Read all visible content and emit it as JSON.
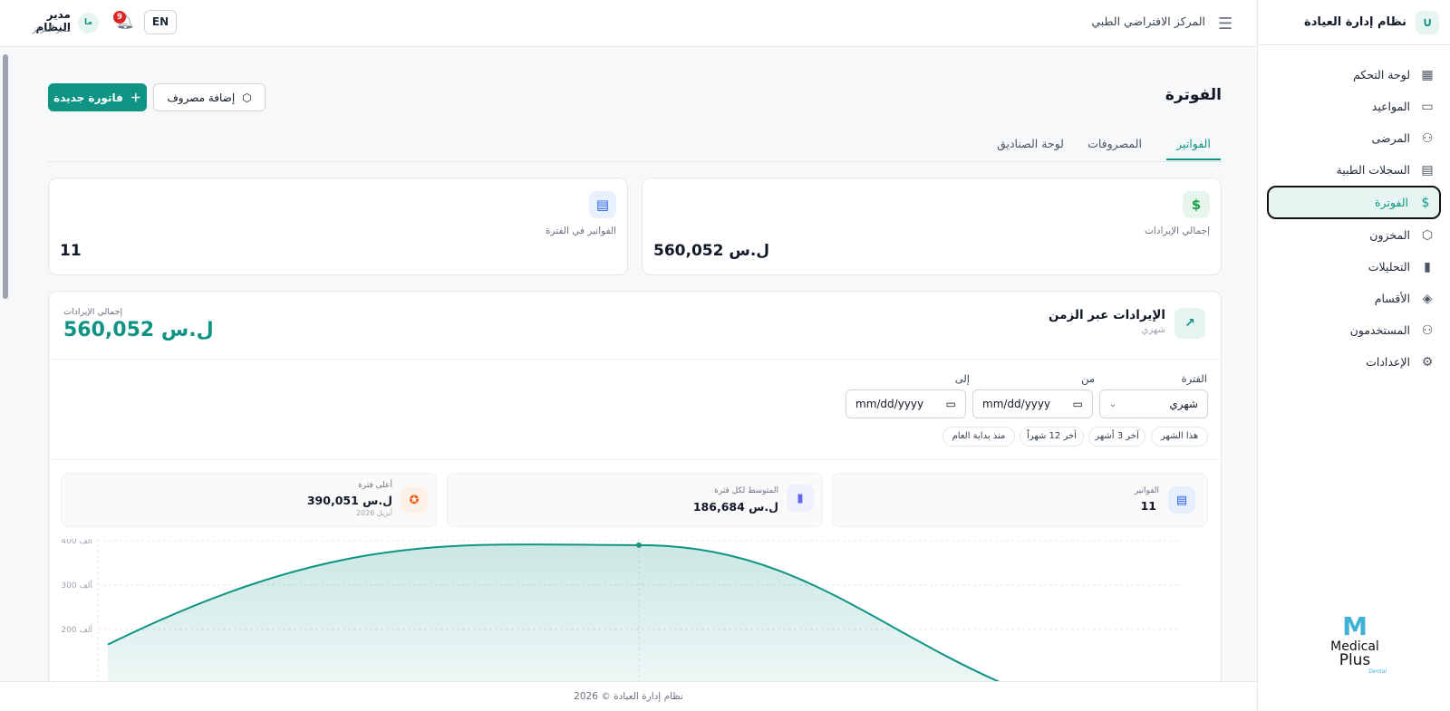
{
  "sidebar": {
    "brand": "نظام إدارة العيادة",
    "items": [
      {
        "label": "لوحة التحكم",
        "icon": "dashboard-icon",
        "glyph": "▦"
      },
      {
        "label": "المواعيد",
        "icon": "calendar-icon",
        "glyph": "▭"
      },
      {
        "label": "المرضى",
        "icon": "users-icon",
        "glyph": "⚇"
      },
      {
        "label": "السجلات الطبية",
        "icon": "file-icon",
        "glyph": "▤"
      },
      {
        "label": "الفوترة",
        "icon": "billing-icon",
        "glyph": "$",
        "active": true
      },
      {
        "label": "المخزون",
        "icon": "box-icon",
        "glyph": "⬡"
      },
      {
        "label": "التحليلات",
        "icon": "bar-chart-icon",
        "glyph": "▮"
      },
      {
        "label": "الأقسام",
        "icon": "layers-icon",
        "glyph": "◈"
      },
      {
        "label": "المستخدمون",
        "icon": "user-group-icon",
        "glyph": "⚇"
      },
      {
        "label": "الإعدادات",
        "icon": "settings-icon",
        "glyph": "⚙"
      }
    ],
    "logo": {
      "line1": "Medical",
      "line2": "Plus",
      "line3": "Dental"
    }
  },
  "header": {
    "center_name": "المركز الافتراضي الطبي",
    "lang": "EN",
    "notifications": "9",
    "avatar": "ما",
    "user_name": "مدير النظام",
    "user_role": "مدير المركز"
  },
  "page": {
    "title": "الفوترة",
    "new_invoice": "فاتورة جديدة",
    "add_expense": "إضافة مصروف",
    "tabs": [
      "الفواتير",
      "المصروفات",
      "لوحة الصناديق"
    ]
  },
  "stats": {
    "revenue_label": "إجمالي الإيرادات",
    "revenue_value": "560,052 ل.س",
    "invoices_label": "الفواتير في الفترة",
    "invoices_value": "11"
  },
  "chart_card": {
    "title": "الإيرادات عبر الزمن",
    "subtitle": "شهري",
    "total_label": "إجمالي الإيرادات",
    "total_value": "560,052 ل.س",
    "period_label": "الفترة",
    "period_value": "شهري",
    "from_label": "من",
    "to_label": "إلى",
    "date_placeholder": "mm/dd/yyyy",
    "chips": [
      "هذا الشهر",
      "آخر 3 أشهر",
      "آخر 12 شهراً",
      "منذ بداية العام"
    ],
    "mini": {
      "invoices_label": "الفواتير",
      "invoices_value": "11",
      "avg_label": "المتوسط لكل فترة",
      "avg_value": "186,684 ل.س",
      "top_label": "أعلى فترة",
      "top_value": "390,051 ل.س",
      "top_sub": "أبريل 2026"
    }
  },
  "colors": {
    "accent": "#0f9483",
    "danger": "#dc2626"
  },
  "chart_data": {
    "type": "area",
    "x": [
      "",
      "أبريل 2026",
      ""
    ],
    "values": [
      166001,
      390051,
      4000
    ],
    "yticks": [
      {
        "v": 200000,
        "label": "200 ألف"
      },
      {
        "v": 300000,
        "label": "300 ألف"
      },
      {
        "v": 400000,
        "label": "400 ألف"
      }
    ],
    "ylim": [
      0,
      400000
    ],
    "grid": true
  },
  "footer": "نظام إدارة العيادة © 2026"
}
